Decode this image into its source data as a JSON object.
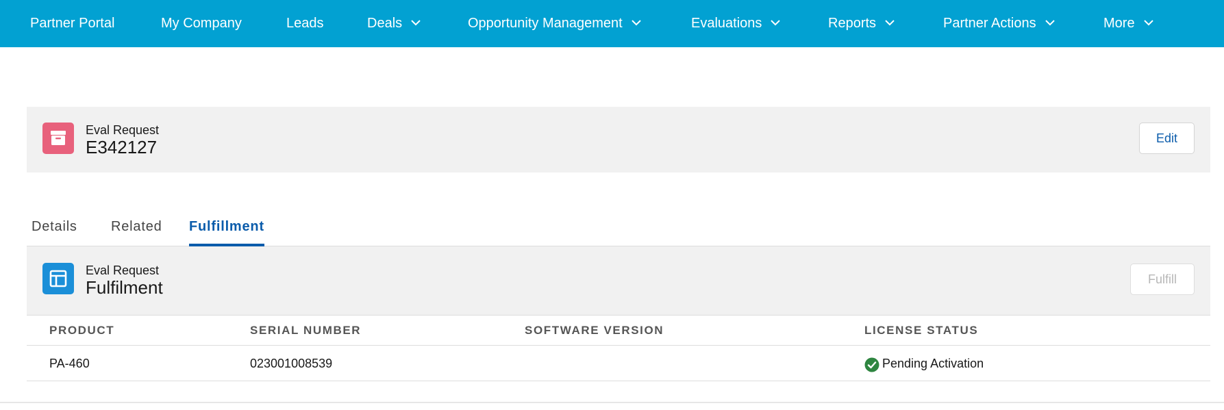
{
  "nav": {
    "items": [
      {
        "label": "Partner Portal",
        "has_menu": false
      },
      {
        "label": "My Company",
        "has_menu": false
      },
      {
        "label": "Leads",
        "has_menu": false
      },
      {
        "label": "Deals",
        "has_menu": true
      },
      {
        "label": "Opportunity Management",
        "has_menu": true
      },
      {
        "label": "Evaluations",
        "has_menu": true
      },
      {
        "label": "Reports",
        "has_menu": true
      },
      {
        "label": "Partner Actions",
        "has_menu": true
      },
      {
        "label": "More",
        "has_menu": true
      }
    ],
    "background": "#02a1d2"
  },
  "record": {
    "type": "Eval Request",
    "title": "E342127",
    "icon": "archive-box-icon",
    "icon_color": "#e8617c",
    "edit_label": "Edit"
  },
  "tabs": [
    {
      "label": "Details",
      "active": false
    },
    {
      "label": "Related",
      "active": false
    },
    {
      "label": "Fulfillment",
      "active": true
    }
  ],
  "fulfilment": {
    "type": "Eval Request",
    "title": "Fulfilment",
    "icon": "layout-panel-icon",
    "icon_color": "#1b8fd8",
    "fulfill_label": "Fulfill",
    "fulfill_disabled": true,
    "columns": [
      "PRODUCT",
      "SERIAL NUMBER",
      "SOFTWARE VERSION",
      "LICENSE STATUS"
    ],
    "rows": [
      {
        "product": "PA-460",
        "serial": "023001008539",
        "version": "",
        "status": "Pending Activation",
        "status_icon": "check-circle-icon",
        "status_color": "#2e8540"
      }
    ]
  }
}
